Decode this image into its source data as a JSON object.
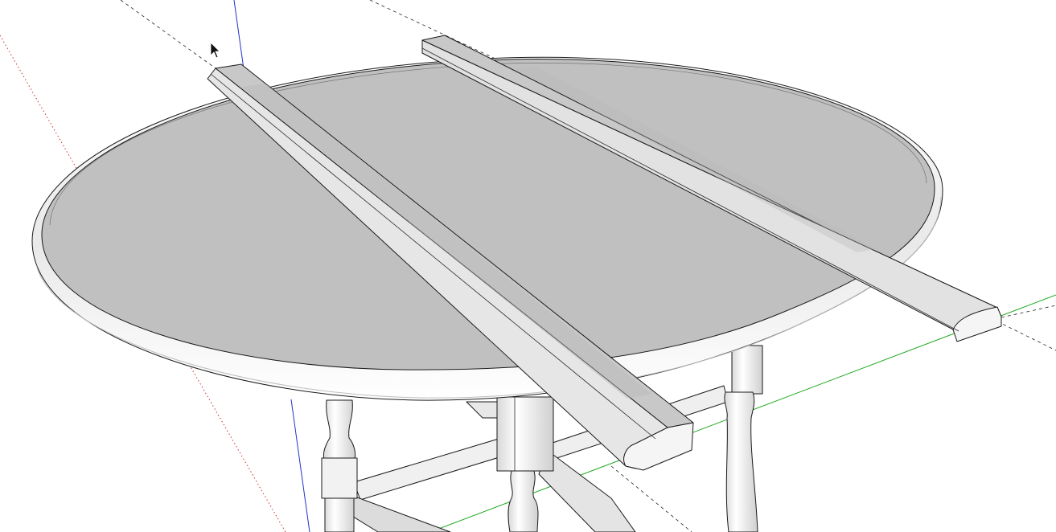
{
  "viewport": {
    "view": "perspective",
    "model": "drop-leaf table",
    "colors": {
      "background": "#ffffff",
      "top_face": "#c0c0c0",
      "rim": "#f1f1f1",
      "rail": "#c9c9c9",
      "leg": "#f3f3f3",
      "edge": "#1a1a1a",
      "axis_red": "#cc3333",
      "axis_green": "#22aa22",
      "axis_blue": "#2233cc",
      "guide": "#222222"
    },
    "cursor": {
      "icon": "arrow-cursor-icon"
    }
  }
}
